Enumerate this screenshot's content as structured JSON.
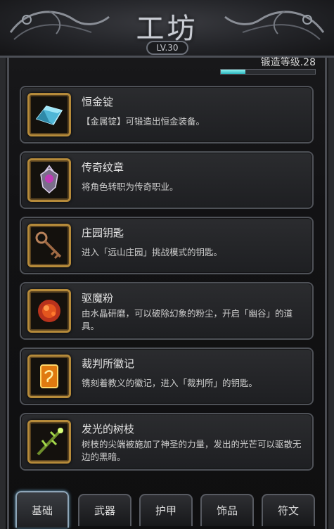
{
  "header": {
    "title": "工坊",
    "level_badge": "LV.30"
  },
  "forge": {
    "level_label": "锻造等级.28",
    "progress": 0.26,
    "bar_color": "#5fd6dc"
  },
  "items": [
    {
      "name": "恒金锭",
      "desc": "【金属锭】可锻造出恒金装备。",
      "icon": "ingot-icon"
    },
    {
      "name": "传奇纹章",
      "desc": "将角色转职为传奇职业。",
      "icon": "emblem-icon"
    },
    {
      "name": "庄园钥匙",
      "desc": "进入「远山庄园」挑战模式的钥匙。",
      "icon": "key-icon"
    },
    {
      "name": "驱魔粉",
      "desc": "由水晶研磨，可以破除幻象的粉尘，开启「幽谷」的道具。",
      "icon": "powder-icon"
    },
    {
      "name": "裁判所徽记",
      "desc": "镌刻着教义的徽记，进入「裁判所」的钥匙。",
      "icon": "insignia-icon"
    },
    {
      "name": "发光的树枝",
      "desc": "树枝的尖端被施加了神圣的力量，发出的光芒可以驱散无边的黑暗。",
      "icon": "branch-icon"
    }
  ],
  "tabs": [
    {
      "label": "基础",
      "active": true
    },
    {
      "label": "武器",
      "active": false
    },
    {
      "label": "护甲",
      "active": false
    },
    {
      "label": "饰品",
      "active": false
    },
    {
      "label": "符文",
      "active": false
    }
  ],
  "colors": {
    "icon_border": "#b58a3a",
    "active_tab_glow": "#6ea9c9"
  }
}
